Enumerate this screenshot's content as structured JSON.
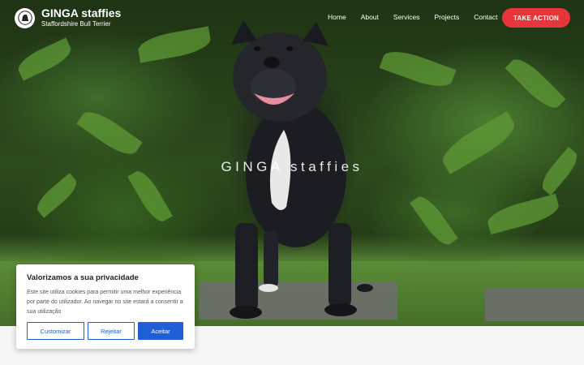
{
  "header": {
    "brand_title": "GINGA staffies",
    "brand_subtitle": "Staffordshire Bull Terrier"
  },
  "nav": {
    "items": [
      {
        "label": "Home"
      },
      {
        "label": "About"
      },
      {
        "label": "Services"
      },
      {
        "label": "Projects"
      },
      {
        "label": "Contact"
      }
    ],
    "cta_label": "TAKE ACTION"
  },
  "hero": {
    "title": "GINGA staffies"
  },
  "cookie_banner": {
    "title": "Valorizamos a sua privacidade",
    "text": "Este site utiliza cookies para permitir uma melhor experiência por parte do utilizador. Ao navegar no site estará a consentir a sua utilização",
    "customize_label": "Customizar",
    "reject_label": "Rejeitar",
    "accept_label": "Aceitar"
  },
  "colors": {
    "cta": "#e6363b",
    "cookie_accent": "#1e5fd6"
  }
}
